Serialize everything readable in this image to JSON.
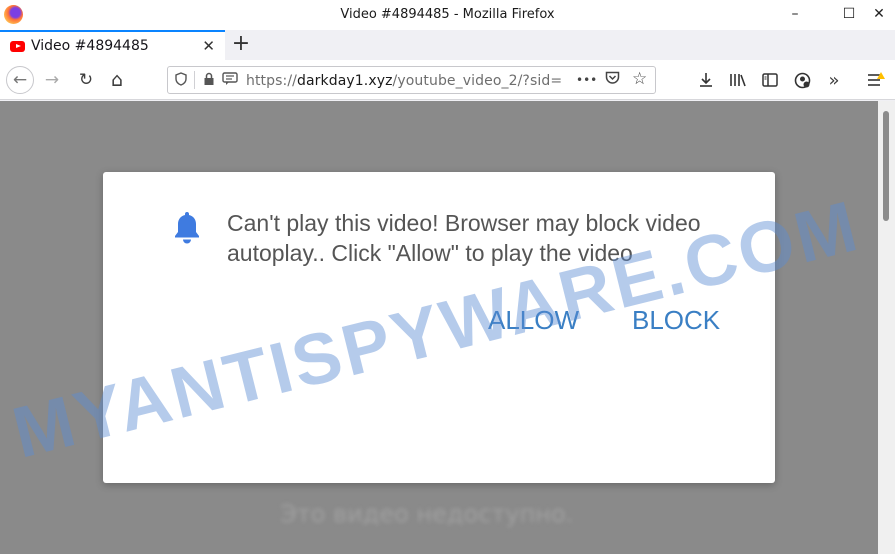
{
  "window": {
    "title": "Video #4894485 - Mozilla Firefox",
    "minimize": "–",
    "maximize": "☐",
    "close": "✕"
  },
  "tabs": [
    {
      "label": "Video #4894485",
      "icon": "youtube-icon",
      "close": "✕"
    }
  ],
  "newtab_label": "+",
  "nav": {
    "back": "←",
    "forward": "→",
    "reload": "↻",
    "home": "⌂"
  },
  "urlbar": {
    "scheme": "https://",
    "host": "darkday1.xyz",
    "path": "/youtube_video_2/?sid=",
    "more": "•••"
  },
  "toolbar_icons": [
    "download-icon",
    "library-icon",
    "sidebar-icon",
    "account-icon",
    "overflow-icon",
    "menu-icon"
  ],
  "page": {
    "blurred_text": "Это видео недоступно."
  },
  "dialog": {
    "message": "Can't play this video! Browser may block video autoplay.. Click \"Allow\" to play the video",
    "allow_label": "ALLOW",
    "block_label": "BLOCK"
  },
  "watermark": "MYANTISPYWARE.COM",
  "colors": {
    "accent": "#0a84ff",
    "dialog_button": "#3a7fc4",
    "bell": "#3f7be0"
  }
}
